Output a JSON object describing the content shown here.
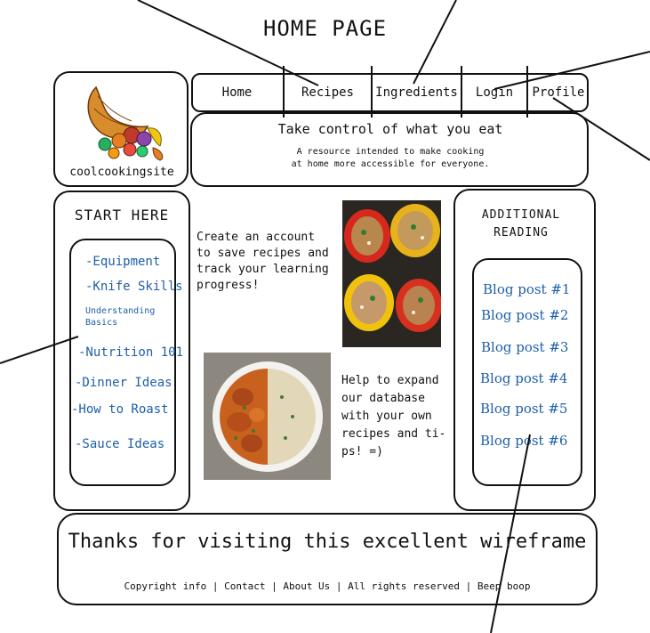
{
  "page_title": "HOME PAGE",
  "logo": {
    "text": "coolcookingsite",
    "icon": "cornucopia-icon"
  },
  "nav": {
    "items": [
      {
        "label": "Home"
      },
      {
        "label": "Recipes"
      },
      {
        "label": "Ingredients"
      },
      {
        "label": "Login"
      },
      {
        "label": "Profile"
      }
    ]
  },
  "header": {
    "tagline": "Take control of what you eat",
    "subline_1": "A resource intended to make cooking",
    "subline_2": "at home more accessible for everyone."
  },
  "start_here": {
    "title": "START HERE",
    "links": [
      "-Equipment",
      "-Knife Skills",
      "Understanding Basics",
      "-Nutrition 101",
      "-Dinner Ideas",
      "-How to Roast",
      "-Sauce Ideas"
    ]
  },
  "main": {
    "intro": "Create an account\nto save recipes and\ntrack your learning\nprogress!",
    "help": "Help to expand\nour database\nwith your own\nrecipes and ti-\nps! =)",
    "image_top": "stuffed-peppers-photo",
    "image_bottom": "curry-rice-photo"
  },
  "additional": {
    "title": "ADDITIONAL\nREADING",
    "links": [
      "Blog post #1",
      "Blog post #2",
      "Blog post #3",
      "Blog post #4",
      "Blog post #5",
      "Blog post #6"
    ]
  },
  "footer": {
    "thanks": "Thanks for visiting this excellent wireframe",
    "copyright": "Copyright info | Contact | About Us | All rights reserved | Beep boop"
  },
  "colors": {
    "link": "#1f5fa8",
    "ink": "#111111"
  }
}
